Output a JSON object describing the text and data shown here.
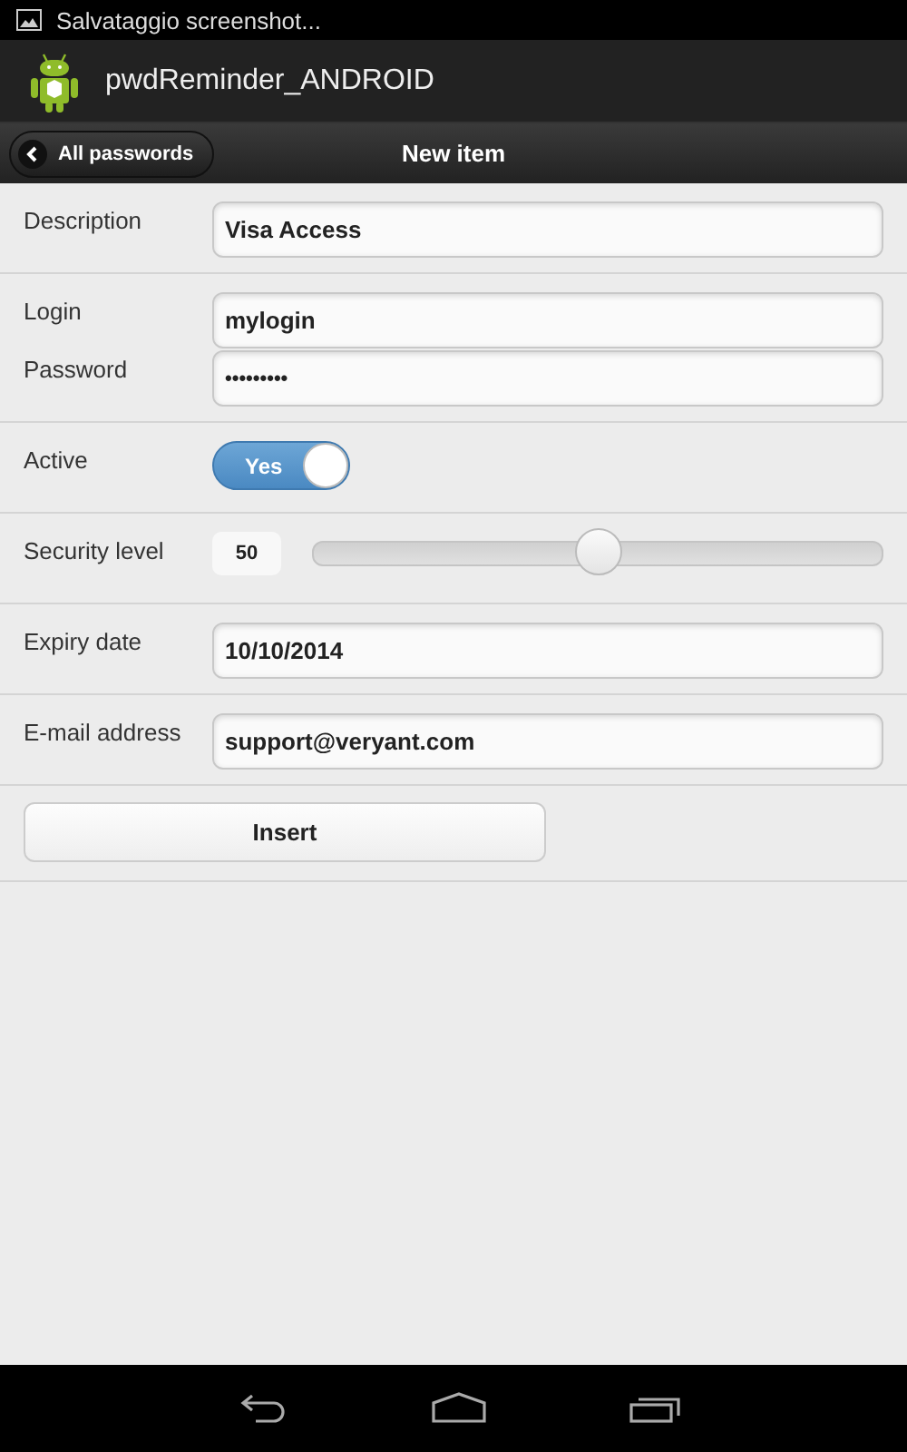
{
  "status_bar": {
    "notification": "Salvataggio screenshot..."
  },
  "action_bar": {
    "title": "pwdReminder_ANDROID"
  },
  "header": {
    "back_button": "All passwords",
    "title": "New item"
  },
  "sections": [
    {
      "fields": [
        {
          "kind": "text",
          "label": "Description",
          "value": "Visa Access"
        }
      ]
    },
    {
      "fields": [
        {
          "kind": "text",
          "label": "Login",
          "value": "mylogin"
        },
        {
          "kind": "password",
          "label": "Password",
          "value": "•••••••••"
        }
      ]
    },
    {
      "fields": [
        {
          "kind": "toggle",
          "label": "Active",
          "on": true,
          "on_text": "Yes"
        }
      ]
    },
    {
      "fields": [
        {
          "kind": "slider",
          "label": "Security level",
          "reading": "50",
          "level": 0.5
        }
      ]
    },
    {
      "fields": [
        {
          "kind": "text",
          "label": "Expiry date",
          "value": "10/10/2014"
        }
      ]
    },
    {
      "fields": [
        {
          "kind": "text",
          "label": "E-mail address",
          "value": "support@veryant.com"
        }
      ]
    }
  ],
  "submit_button": "Insert"
}
